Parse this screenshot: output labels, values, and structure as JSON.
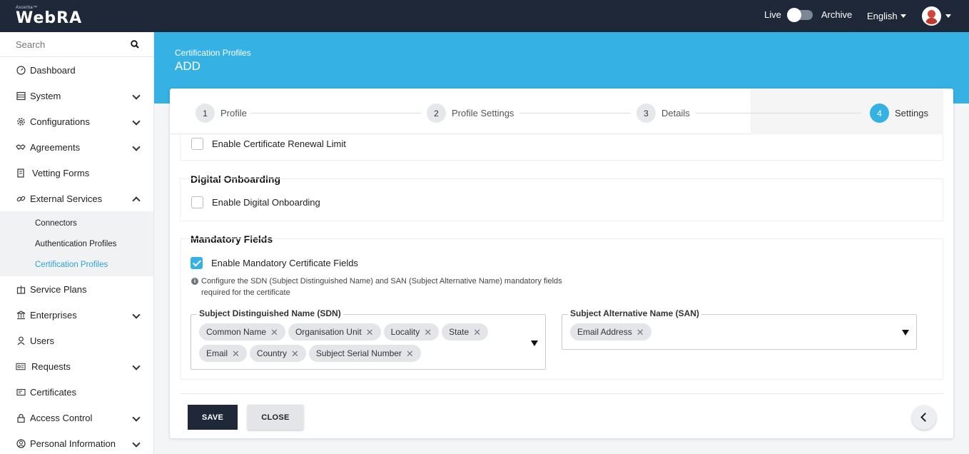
{
  "app": {
    "brand_small": "Ascertia™",
    "brand": "WebRA"
  },
  "topbar": {
    "live_label": "Live",
    "archive_label": "Archive",
    "language": "English"
  },
  "sidebar": {
    "search_placeholder": "Search",
    "items": [
      {
        "label": "Dashboard",
        "icon": "dashboard-icon"
      },
      {
        "label": "System",
        "icon": "system-icon"
      },
      {
        "label": "Configurations",
        "icon": "gear-icon"
      },
      {
        "label": "Agreements",
        "icon": "handshake-icon"
      },
      {
        "label": "Vetting Forms",
        "icon": "form-icon"
      },
      {
        "label": "External Services",
        "icon": "link-icon"
      },
      {
        "label": "Service Plans",
        "icon": "gift-icon"
      },
      {
        "label": "Enterprises",
        "icon": "bank-icon"
      },
      {
        "label": "Users",
        "icon": "user-icon"
      },
      {
        "label": "Requests",
        "icon": "requests-icon"
      },
      {
        "label": "Certificates",
        "icon": "certificate-icon"
      },
      {
        "label": "Access Control",
        "icon": "lock-icon"
      },
      {
        "label": "Personal Information",
        "icon": "person-circle-icon"
      }
    ],
    "submenu": [
      "Connectors",
      "Authentication Profiles",
      "Certification Profiles"
    ]
  },
  "header": {
    "breadcrumb": "Certification Profiles",
    "title": "ADD"
  },
  "steps": [
    {
      "num": "1",
      "label": "Profile"
    },
    {
      "num": "2",
      "label": "Profile Settings"
    },
    {
      "num": "3",
      "label": "Details"
    },
    {
      "num": "4",
      "label": "Settings"
    }
  ],
  "sections": {
    "renewal_label": "Enable Certificate Renewal Limit",
    "digital_onboarding": {
      "title": "Digital Onboarding",
      "checkbox_label": "Enable Digital Onboarding",
      "checked": false
    },
    "mandatory": {
      "title": "Mandatory Fields",
      "checkbox_label": "Enable Mandatory Certificate Fields",
      "checked": true,
      "note": "Configure the SDN (Subject Distinguished Name) and SAN (Subject Alternative Name) mandatory fields required for the certificate",
      "sdn_label": "Subject Distinguished Name (SDN)",
      "sdn_chips": [
        "Common Name",
        "Organisation Unit",
        "Locality",
        "State",
        "Email",
        "Country",
        "Subject Serial Number"
      ],
      "san_label": "Subject Alternative Name (SAN)",
      "san_chips": [
        "Email Address"
      ]
    }
  },
  "actions": {
    "save": "SAVE",
    "close": "CLOSE"
  },
  "colors": {
    "accent": "#35b1e4",
    "dark": "#1e2838"
  }
}
